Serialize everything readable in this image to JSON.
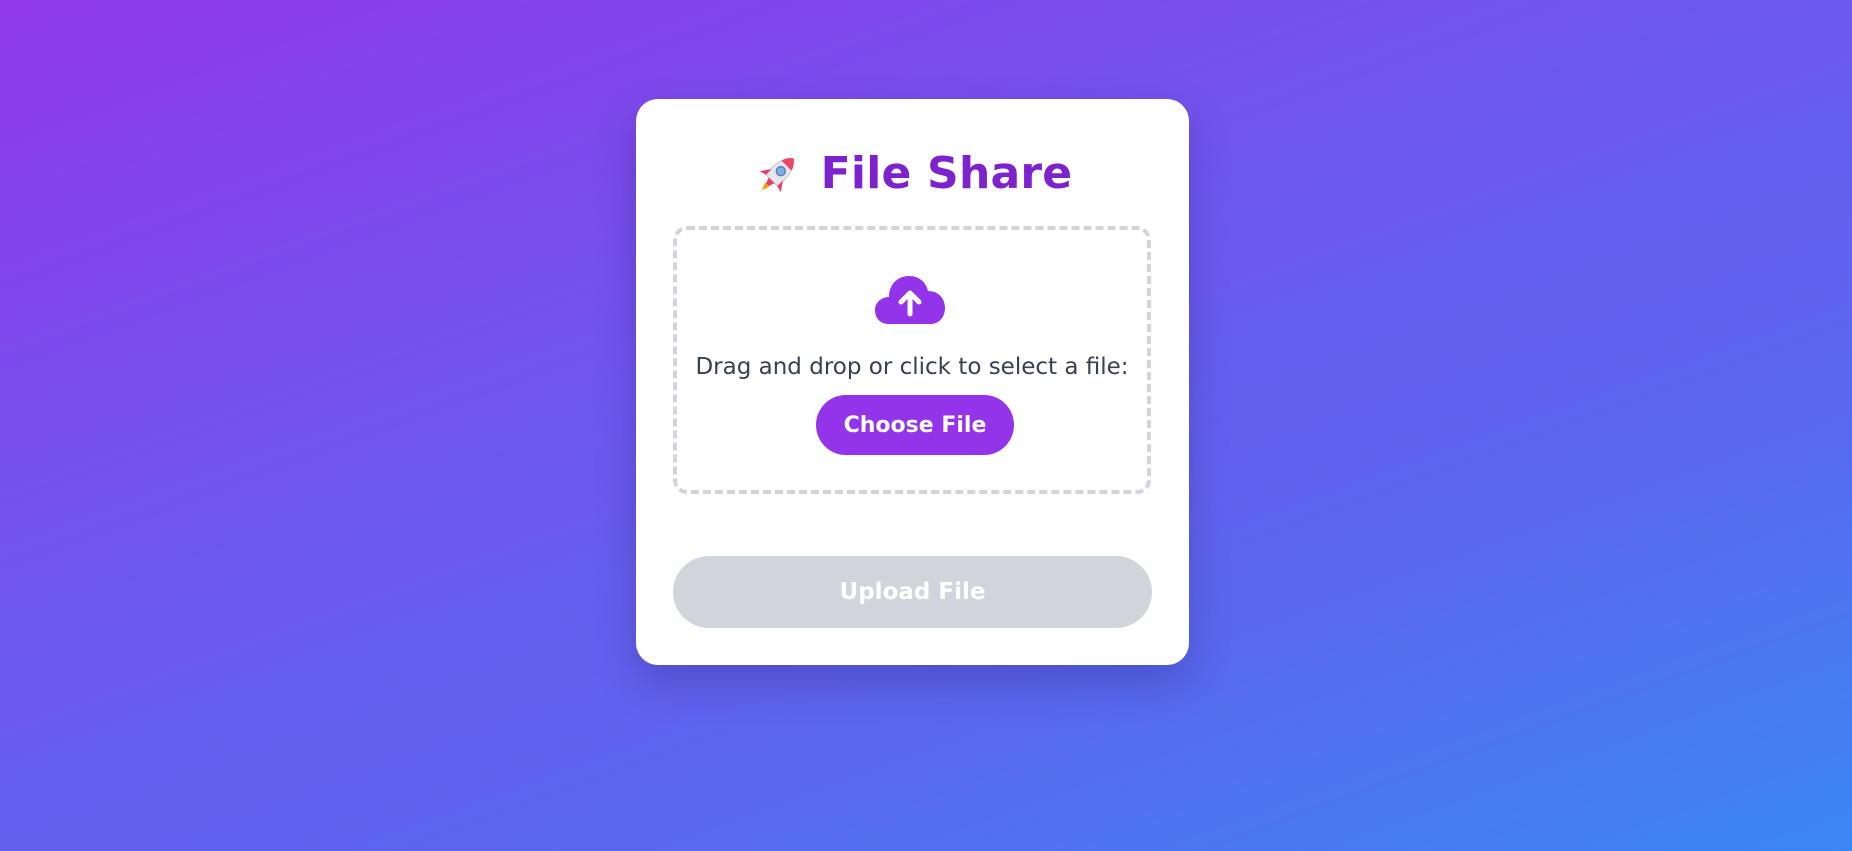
{
  "app": {
    "title": "File Share",
    "title_icon": "rocket-icon",
    "accent_color": "#7e22ce"
  },
  "dropzone": {
    "icon": "cloud-upload-icon",
    "instruction": "Drag and drop or click to select a file:",
    "choose_label": "Choose File",
    "choose_color": "#9333ea"
  },
  "upload": {
    "label": "Upload File",
    "state": "disabled",
    "color": "#d1d5db"
  }
}
